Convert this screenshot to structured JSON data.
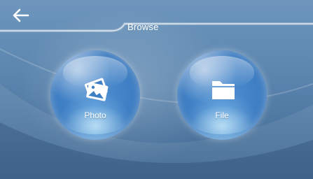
{
  "header": {
    "title": "Browse",
    "back_icon": "arrow-left-icon"
  },
  "tiles": [
    {
      "label": "Photo",
      "icon": "photos-icon"
    },
    {
      "label": "File",
      "icon": "folder-icon"
    }
  ],
  "colors": {
    "bubble": "#3f7fc4",
    "background": "#5d86ad",
    "text": "#ffffff"
  }
}
